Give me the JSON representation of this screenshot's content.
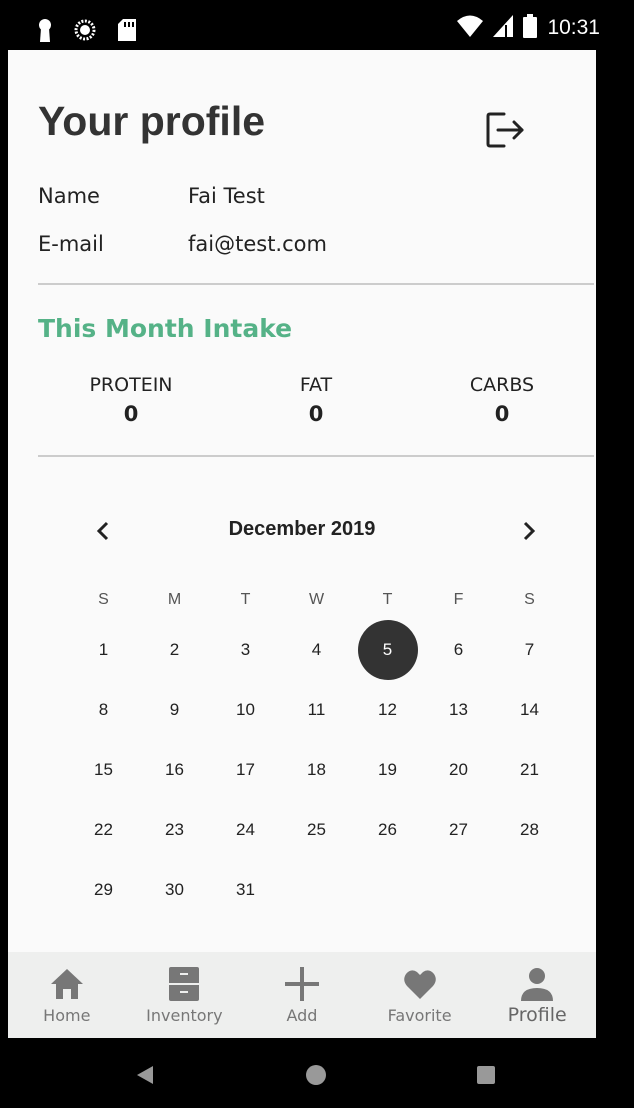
{
  "status_bar": {
    "time": "10:31",
    "left_icons": [
      "keyhole-icon",
      "sync-icon",
      "sd-card-icon"
    ],
    "right_icons": [
      "wifi-icon",
      "signal-icon",
      "battery-icon"
    ]
  },
  "profile": {
    "title": "Your profile",
    "name_label": "Name",
    "name_value": "Fai Test",
    "email_label": "E-mail",
    "email_value": "fai@test.com"
  },
  "intake": {
    "title": "This Month Intake",
    "nutrients": [
      {
        "label": "PROTEIN",
        "value": "0"
      },
      {
        "label": "FAT",
        "value": "0"
      },
      {
        "label": "CARBS",
        "value": "0"
      }
    ]
  },
  "calendar": {
    "month_title": "December 2019",
    "days_of_week": [
      "S",
      "M",
      "T",
      "W",
      "T",
      "F",
      "S"
    ],
    "selected_day": "5",
    "weeks": [
      [
        "1",
        "2",
        "3",
        "4",
        "5",
        "6",
        "7"
      ],
      [
        "8",
        "9",
        "10",
        "11",
        "12",
        "13",
        "14"
      ],
      [
        "15",
        "16",
        "17",
        "18",
        "19",
        "20",
        "21"
      ],
      [
        "22",
        "23",
        "24",
        "25",
        "26",
        "27",
        "28"
      ],
      [
        "29",
        "30",
        "31",
        "",
        "",
        "",
        ""
      ]
    ]
  },
  "bottom_nav": {
    "active": "Profile",
    "items": [
      {
        "label": "Home",
        "icon": "home-icon"
      },
      {
        "label": "Inventory",
        "icon": "cabinet-icon"
      },
      {
        "label": "Add",
        "icon": "plus-icon"
      },
      {
        "label": "Favorite",
        "icon": "heart-icon"
      },
      {
        "label": "Profile",
        "icon": "person-icon"
      }
    ]
  },
  "colors": {
    "accent_green": "#55b287",
    "selected_day_bg": "#333333",
    "nav_icon": "#777777"
  }
}
